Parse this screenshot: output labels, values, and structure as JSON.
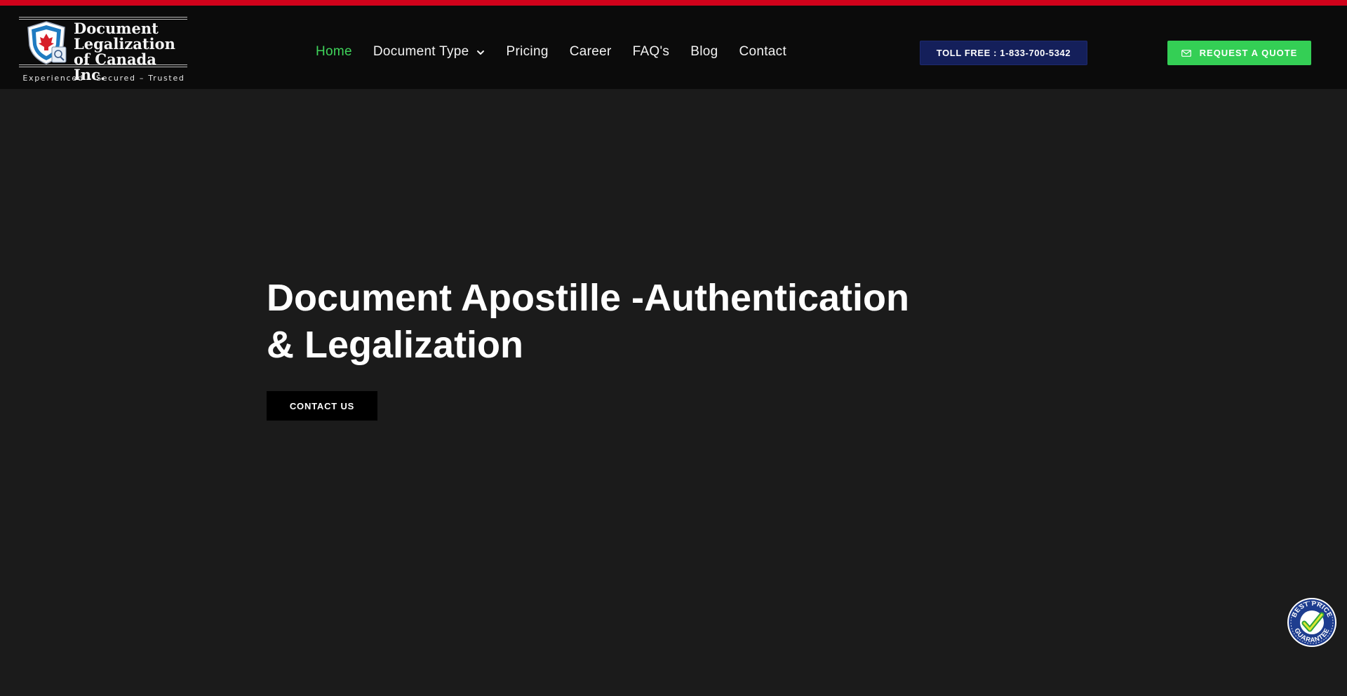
{
  "colors": {
    "top_strip": "#d0021b",
    "header_bg": "#0b0b0b",
    "page_bg": "#1b1b1b",
    "nav_active": "#3fd35a",
    "toll_free_bg": "#141f5a",
    "quote_bg": "#34cf55",
    "contact_bg": "#000000"
  },
  "logo": {
    "line1": "Document",
    "line2": "Legalization",
    "line3": "of Canada Inc.",
    "tagline": "Experienced – Secured – Trusted",
    "icon": "maple-leaf-shield-icon"
  },
  "nav": {
    "items": [
      {
        "label": "Home",
        "active": true
      },
      {
        "label": "Document Type",
        "has_dropdown": true
      },
      {
        "label": "Pricing"
      },
      {
        "label": "Career"
      },
      {
        "label": "FAQ's"
      },
      {
        "label": "Blog"
      },
      {
        "label": "Contact"
      }
    ]
  },
  "toll_free": {
    "label": "TOLL FREE : 1-833-700-5342"
  },
  "quote": {
    "label": "REQUEST A QUOTE",
    "icon": "envelope-icon"
  },
  "hero": {
    "title_line1": "Document Apostille -Authentication",
    "title_line2": "& Legalization",
    "cta_label": "CONTACT US"
  },
  "badge": {
    "text_top": "BEST PRICE",
    "text_bottom": "GUARANTEE",
    "icon": "checkmark-icon"
  }
}
